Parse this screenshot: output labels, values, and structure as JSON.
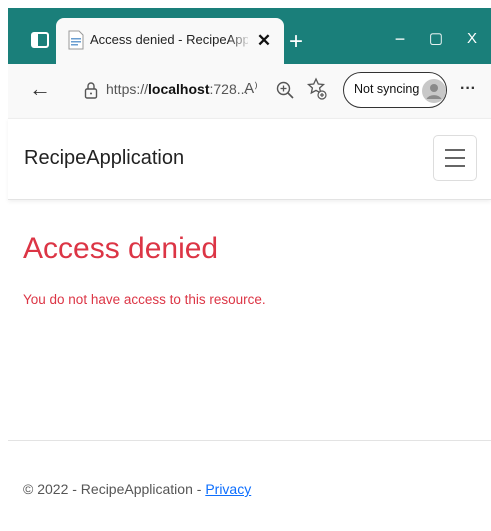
{
  "browser": {
    "tab_title": "Access denied - RecipeApplication",
    "tab_close": "✕",
    "new_tab": "+",
    "window_minimize": "−",
    "window_maximize": "▢",
    "window_close": "X",
    "back": "←",
    "url_prefix": "https://",
    "url_host": "localhost",
    "url_rest": ":728...",
    "read_aloud": "A⁾",
    "sync_label": "Not syncing",
    "more": "···"
  },
  "page": {
    "brand": "RecipeApplication",
    "heading": "Access denied",
    "message": "You do not have access to this resource.",
    "footer_text": "© 2022 - RecipeApplication - ",
    "footer_link": "Privacy",
    "error_color": "#dc3545",
    "link_color": "#0d6efd"
  },
  "icons": {
    "window": "window-icon",
    "favicon": "page-favicon-icon",
    "lock": "lock-icon",
    "zoom": "zoom-icon",
    "favorites": "favorites-icon",
    "avatar": "avatar-icon",
    "menu": "hamburger-menu-icon"
  },
  "colors": {
    "titlebar": "#1a7f7a",
    "toolbar": "#f9f9f9"
  }
}
